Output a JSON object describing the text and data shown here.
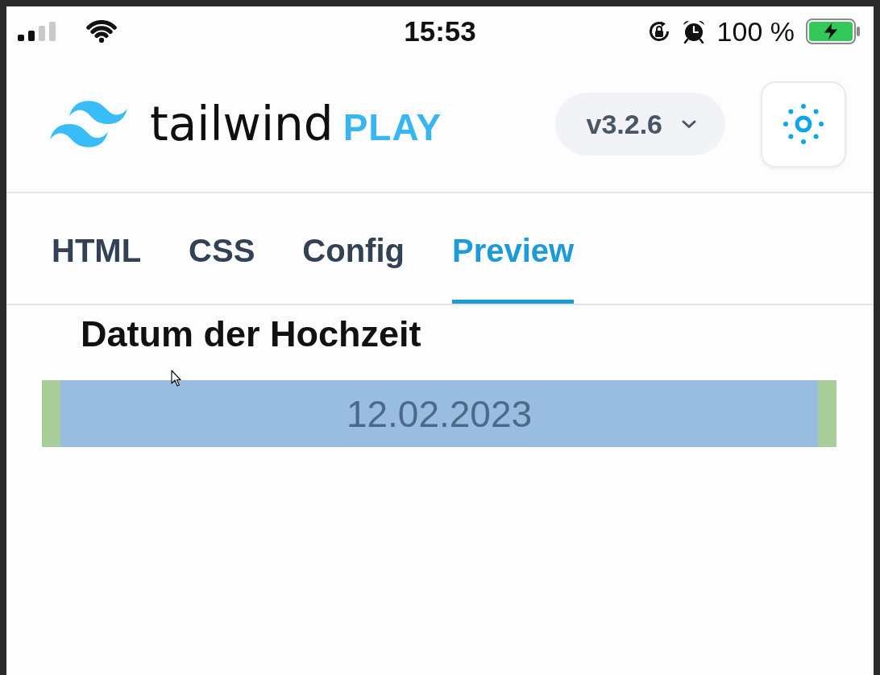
{
  "status_bar": {
    "time": "15:53",
    "battery": "100 %"
  },
  "header": {
    "logo_text": "tailwind",
    "logo_product": "PLAY",
    "version": "v3.2.6"
  },
  "tabs": [
    {
      "label": "HTML",
      "selected": false
    },
    {
      "label": "CSS",
      "selected": false
    },
    {
      "label": "Config",
      "selected": false
    },
    {
      "label": "Preview",
      "selected": true
    }
  ],
  "preview": {
    "field_label": "Datum der Hochzeit",
    "date_value": "12.02.2023"
  }
}
